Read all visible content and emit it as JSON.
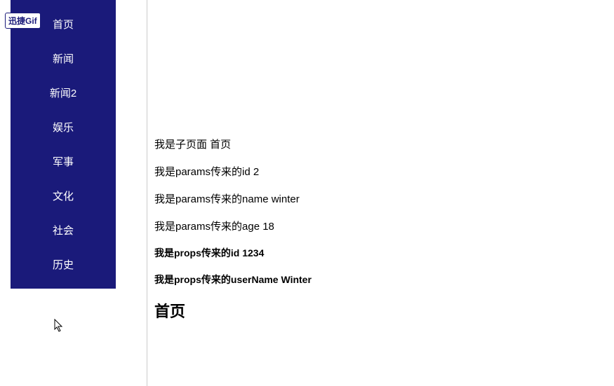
{
  "badge": {
    "label": "迅捷Gif"
  },
  "sidebar": {
    "items": [
      {
        "label": "首页"
      },
      {
        "label": "新闻"
      },
      {
        "label": "新闻2"
      },
      {
        "label": "娱乐"
      },
      {
        "label": "军事"
      },
      {
        "label": "文化"
      },
      {
        "label": "社会"
      },
      {
        "label": "历史"
      }
    ]
  },
  "main": {
    "lines": [
      "我是子页面 首页",
      "我是params传来的id 2",
      "我是params传来的name winter",
      "我是params传来的age 18"
    ],
    "boldLines": [
      "我是props传来的id 1234",
      "我是props传来的userName Winter"
    ],
    "heading": "首页"
  }
}
